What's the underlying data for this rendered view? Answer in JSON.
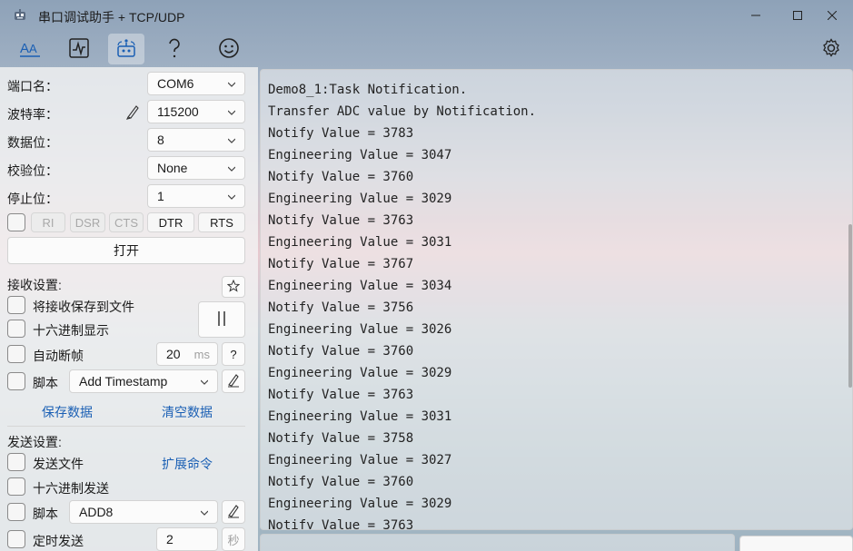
{
  "window": {
    "title": "串口调试助手 + TCP/UDP",
    "app_icon": "robot-icon",
    "controls": [
      "minimize-icon",
      "maximize-icon",
      "close-icon"
    ]
  },
  "toolbar": {
    "items": [
      {
        "icon": "font-aa-icon",
        "active": false
      },
      {
        "icon": "waveform-chart-icon",
        "active": false
      },
      {
        "icon": "network-icon",
        "active": true
      },
      {
        "icon": "question-icon",
        "active": false
      },
      {
        "icon": "smiley-icon",
        "active": false
      }
    ],
    "settings_icon": "gear-icon"
  },
  "serial": {
    "port_label": "端口名：",
    "port_value": "COM6",
    "baud_label": "波特率：",
    "baud_value": "115200",
    "databits_label": "数据位：",
    "databits_value": "8",
    "parity_label": "校验位：",
    "parity_value": "None",
    "stopbits_label": "停止位：",
    "stopbits_value": "1",
    "signals": {
      "ri": "RI",
      "dsr": "DSR",
      "cts": "CTS",
      "dtr": "DTR",
      "rts": "RTS"
    },
    "open_button": "打开"
  },
  "receive": {
    "section_label": "接收设置:",
    "save_to_file": "将接收保存到文件",
    "hex_display": "十六进制显示",
    "auto_frame": "自动断帧",
    "frame_value": "20",
    "frame_unit": "ms",
    "help": "?",
    "script_label": "脚本",
    "script_value": "Add Timestamp",
    "save_data": "保存数据",
    "clear_data": "清空数据"
  },
  "send": {
    "section_label": "发送设置:",
    "send_file": "发送文件",
    "ext_commands": "扩展命令",
    "hex_send": "十六进制发送",
    "script_label": "脚本",
    "script_value": "ADD8",
    "timed_send": "定时发送",
    "timed_value": "2",
    "timed_unit": "秒"
  },
  "output": {
    "lines": [
      "Demo8_1:Task Notification.",
      "Transfer ADC value by Notification.",
      "Notify Value = 3783",
      "Engineering Value = 3047",
      "Notify Value = 3760",
      "Engineering Value = 3029",
      "Notify Value = 3763",
      "Engineering Value = 3031",
      "Notify Value = 3767",
      "Engineering Value = 3034",
      "Notify Value = 3756",
      "Engineering Value = 3026",
      "Notify Value = 3760",
      "Engineering Value = 3029",
      "Notify Value = 3763",
      "Engineering Value = 3031",
      "Notify Value = 3758",
      "Engineering Value = 3027",
      "Notify Value = 3760",
      "Engineering Value = 3029",
      "Notify Value = 3763"
    ]
  }
}
